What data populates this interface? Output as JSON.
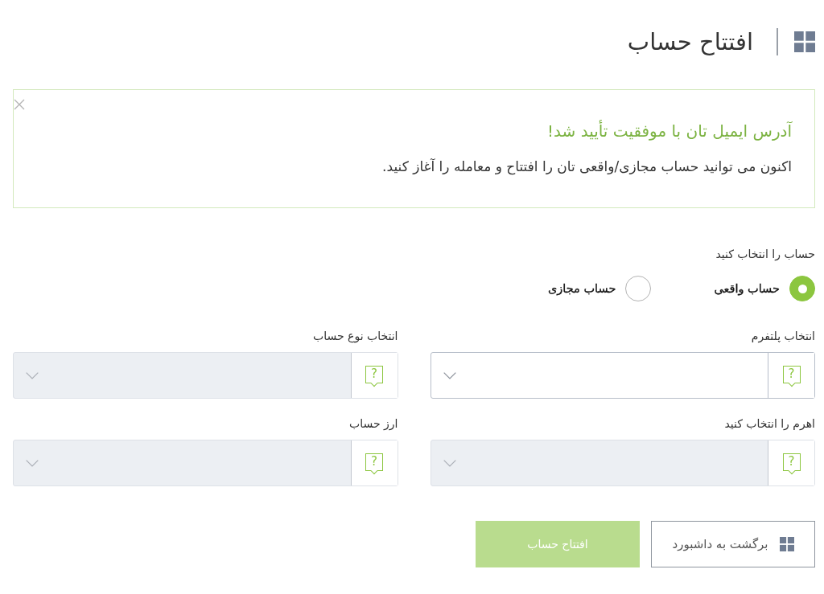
{
  "header": {
    "title": "افتتاح حساب"
  },
  "alert": {
    "title": "آدرس ایمیل تان با موفقیت تأیید شد!",
    "message": "اکنون می توانید حساب مجازی/واقعی تان را افتتاح و معامله را آغاز کنید."
  },
  "account_type": {
    "label": "حساب را انتخاب کنید",
    "options": [
      {
        "label": "حساب واقعی",
        "selected": true
      },
      {
        "label": "حساب مجازی",
        "selected": false
      }
    ]
  },
  "fields": [
    {
      "label": "انتخاب پلتفرم",
      "help": "?",
      "disabled": false
    },
    {
      "label": "انتخاب نوع حساب",
      "help": "?",
      "disabled": true
    },
    {
      "label": "اهرم را انتخاب کنید",
      "help": "?",
      "disabled": true
    },
    {
      "label": "ارز حساب",
      "help": "?",
      "disabled": true
    }
  ],
  "buttons": [
    {
      "kind": "back",
      "label": "برگشت به داشبورد",
      "disabled": false
    },
    {
      "kind": "submit",
      "label": "افتتاح حساب",
      "disabled": true
    }
  ]
}
